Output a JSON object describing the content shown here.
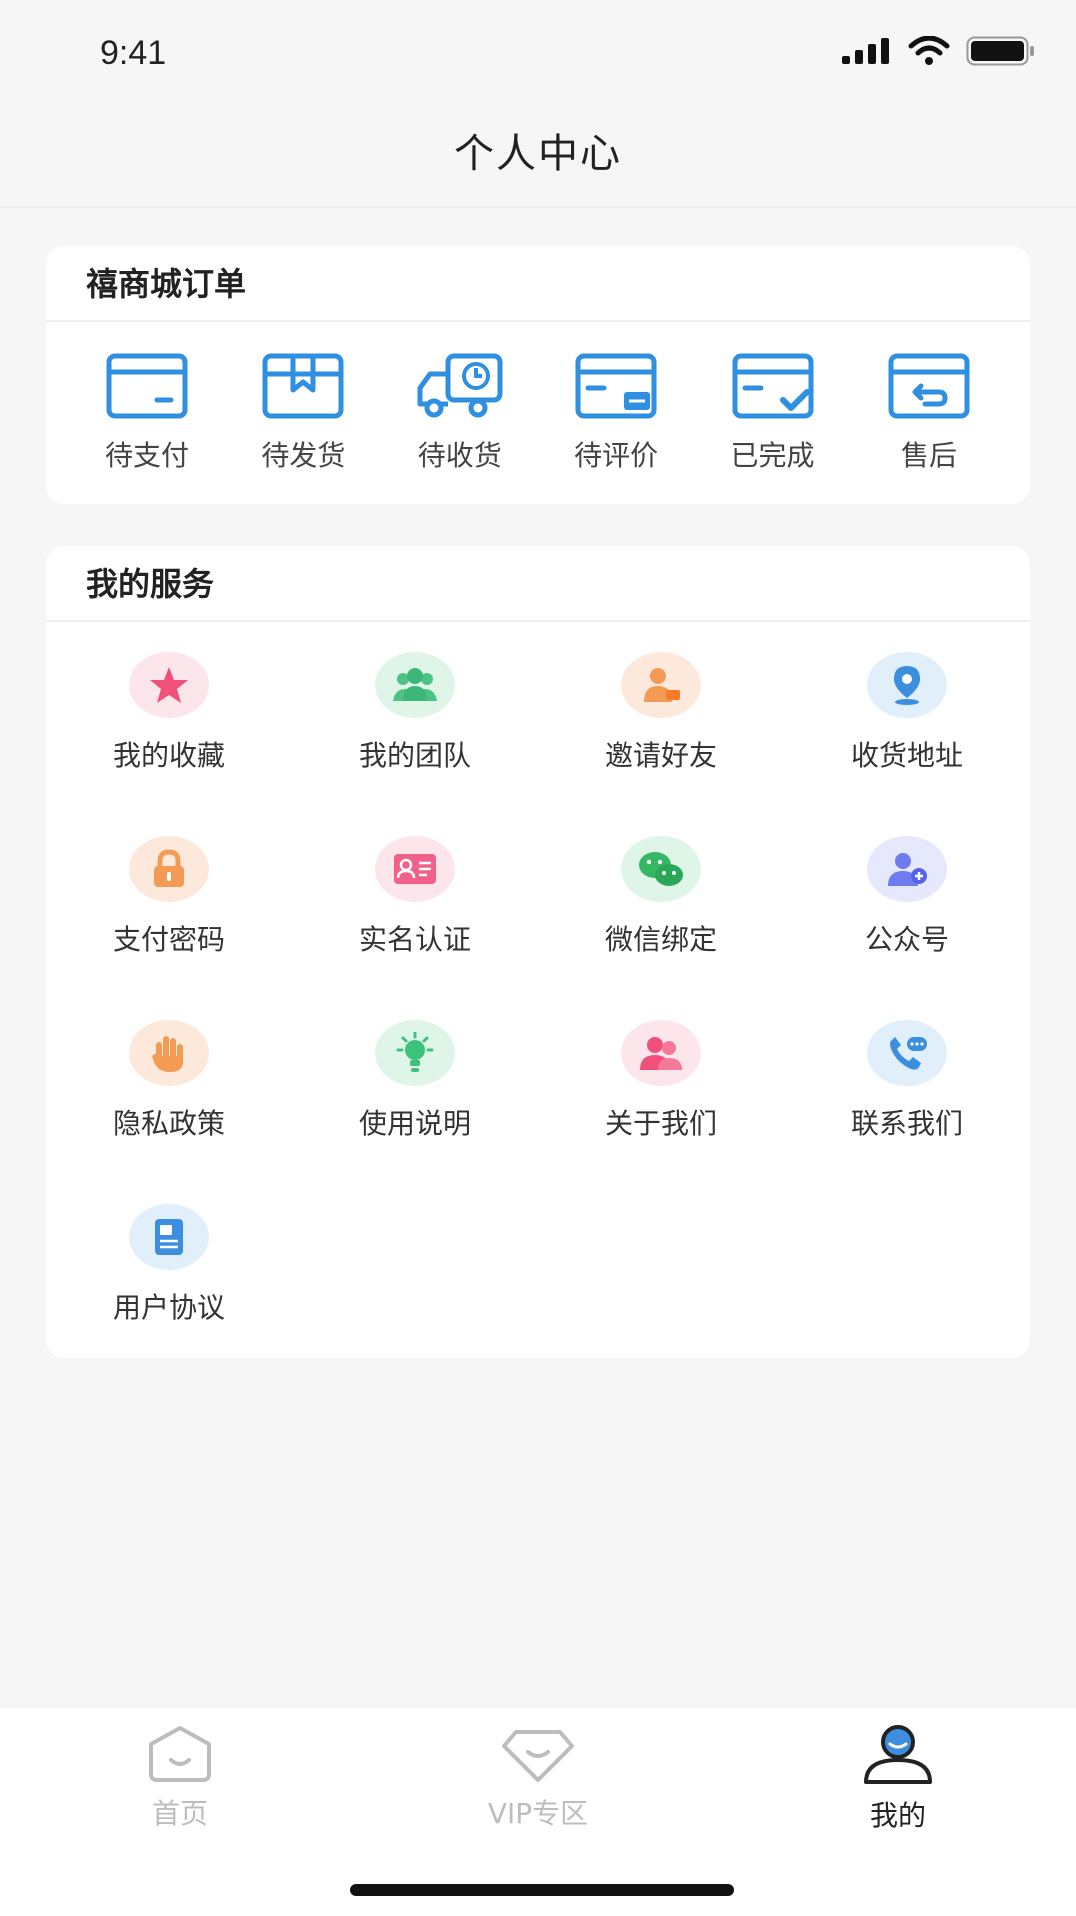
{
  "status_bar": {
    "time": "9:41"
  },
  "header": {
    "title": "个人中心"
  },
  "orders": {
    "title": "禧商城订单",
    "items": [
      {
        "label": "待支付",
        "icon": "wallet-icon"
      },
      {
        "label": "待发货",
        "icon": "package-icon"
      },
      {
        "label": "待收货",
        "icon": "truck-icon"
      },
      {
        "label": "待评价",
        "icon": "review-icon"
      },
      {
        "label": "已完成",
        "icon": "completed-icon"
      },
      {
        "label": "售后",
        "icon": "after-sale-icon"
      }
    ],
    "accent": "#2f8fe0"
  },
  "services": {
    "title": "我的服务",
    "items": [
      {
        "label": "我的收藏",
        "icon": "star-icon"
      },
      {
        "label": "我的团队",
        "icon": "team-icon"
      },
      {
        "label": "邀请好友",
        "icon": "invite-icon"
      },
      {
        "label": "收货地址",
        "icon": "location-icon"
      },
      {
        "label": "支付密码",
        "icon": "lock-icon"
      },
      {
        "label": "实名认证",
        "icon": "id-card-icon"
      },
      {
        "label": "微信绑定",
        "icon": "wechat-icon"
      },
      {
        "label": "公众号",
        "icon": "official-account-icon"
      },
      {
        "label": "隐私政策",
        "icon": "hand-icon"
      },
      {
        "label": "使用说明",
        "icon": "lightbulb-icon"
      },
      {
        "label": "关于我们",
        "icon": "about-us-icon"
      },
      {
        "label": "联系我们",
        "icon": "phone-icon"
      },
      {
        "label": "用户协议",
        "icon": "document-icon"
      }
    ]
  },
  "tab_bar": {
    "tabs": [
      {
        "label": "首页",
        "icon": "home-icon",
        "active": false
      },
      {
        "label": "VIP专区",
        "icon": "vip-diamond-icon",
        "active": false
      },
      {
        "label": "我的",
        "icon": "profile-icon",
        "active": true
      }
    ]
  }
}
